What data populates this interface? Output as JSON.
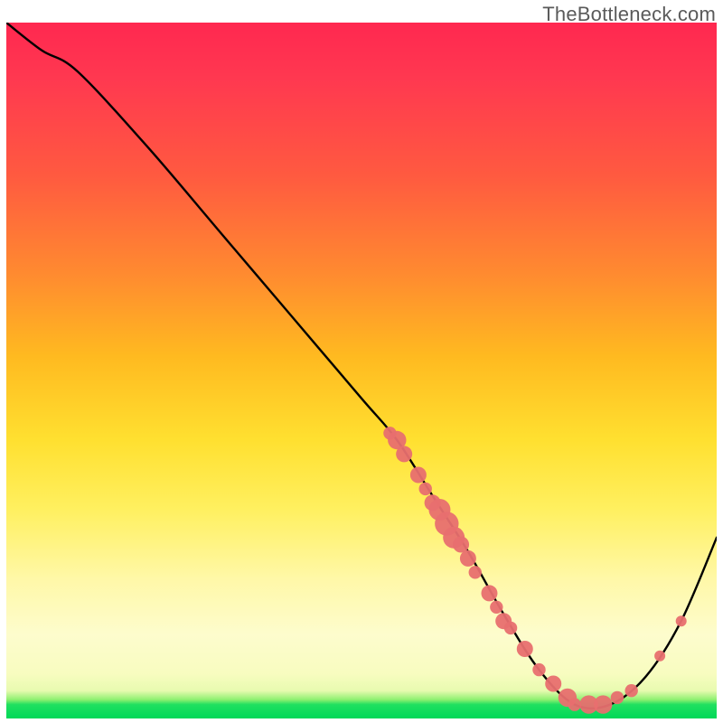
{
  "watermark": "TheBottleneck.com",
  "chart_data": {
    "type": "line",
    "title": "",
    "xlabel": "",
    "ylabel": "",
    "xlim": [
      0,
      100
    ],
    "ylim": [
      0,
      100
    ],
    "series": [
      {
        "name": "curve",
        "x": [
          0,
          5,
          10,
          20,
          30,
          40,
          50,
          55,
          60,
          65,
          70,
          75,
          80,
          85,
          90,
          95,
          100
        ],
        "y": [
          100,
          96,
          93,
          82,
          70,
          58,
          46,
          40,
          32,
          24,
          15,
          7,
          2,
          2,
          6,
          14,
          26
        ]
      }
    ],
    "markers": [
      {
        "x": 54,
        "y": 41,
        "size": 1.2
      },
      {
        "x": 55,
        "y": 40,
        "size": 1.7
      },
      {
        "x": 56,
        "y": 38,
        "size": 1.5
      },
      {
        "x": 58,
        "y": 35,
        "size": 1.5
      },
      {
        "x": 59,
        "y": 33,
        "size": 1.2
      },
      {
        "x": 60,
        "y": 31,
        "size": 1.5
      },
      {
        "x": 61,
        "y": 30,
        "size": 2.0
      },
      {
        "x": 62,
        "y": 28,
        "size": 2.2
      },
      {
        "x": 63,
        "y": 26,
        "size": 2.0
      },
      {
        "x": 64,
        "y": 25,
        "size": 1.5
      },
      {
        "x": 65,
        "y": 23,
        "size": 1.5
      },
      {
        "x": 66,
        "y": 21,
        "size": 1.2
      },
      {
        "x": 68,
        "y": 18,
        "size": 1.5
      },
      {
        "x": 69,
        "y": 16,
        "size": 1.2
      },
      {
        "x": 70,
        "y": 14,
        "size": 1.5
      },
      {
        "x": 71,
        "y": 13,
        "size": 1.2
      },
      {
        "x": 73,
        "y": 10,
        "size": 1.5
      },
      {
        "x": 75,
        "y": 7,
        "size": 1.2
      },
      {
        "x": 77,
        "y": 5,
        "size": 1.5
      },
      {
        "x": 79,
        "y": 3,
        "size": 1.7
      },
      {
        "x": 80,
        "y": 2,
        "size": 1.2
      },
      {
        "x": 82,
        "y": 2,
        "size": 1.7
      },
      {
        "x": 84,
        "y": 2,
        "size": 1.7
      },
      {
        "x": 86,
        "y": 3,
        "size": 1.2
      },
      {
        "x": 88,
        "y": 4,
        "size": 1.2
      },
      {
        "x": 92,
        "y": 9,
        "size": 1.0
      },
      {
        "x": 95,
        "y": 14,
        "size": 1.0
      }
    ],
    "gradient_stops": [
      {
        "pct": 0,
        "color": "#ff2850"
      },
      {
        "pct": 35,
        "color": "#ff8a30"
      },
      {
        "pct": 60,
        "color": "#ffe030"
      },
      {
        "pct": 88,
        "color": "#fdfccd"
      },
      {
        "pct": 100,
        "color": "#00d858"
      }
    ]
  }
}
